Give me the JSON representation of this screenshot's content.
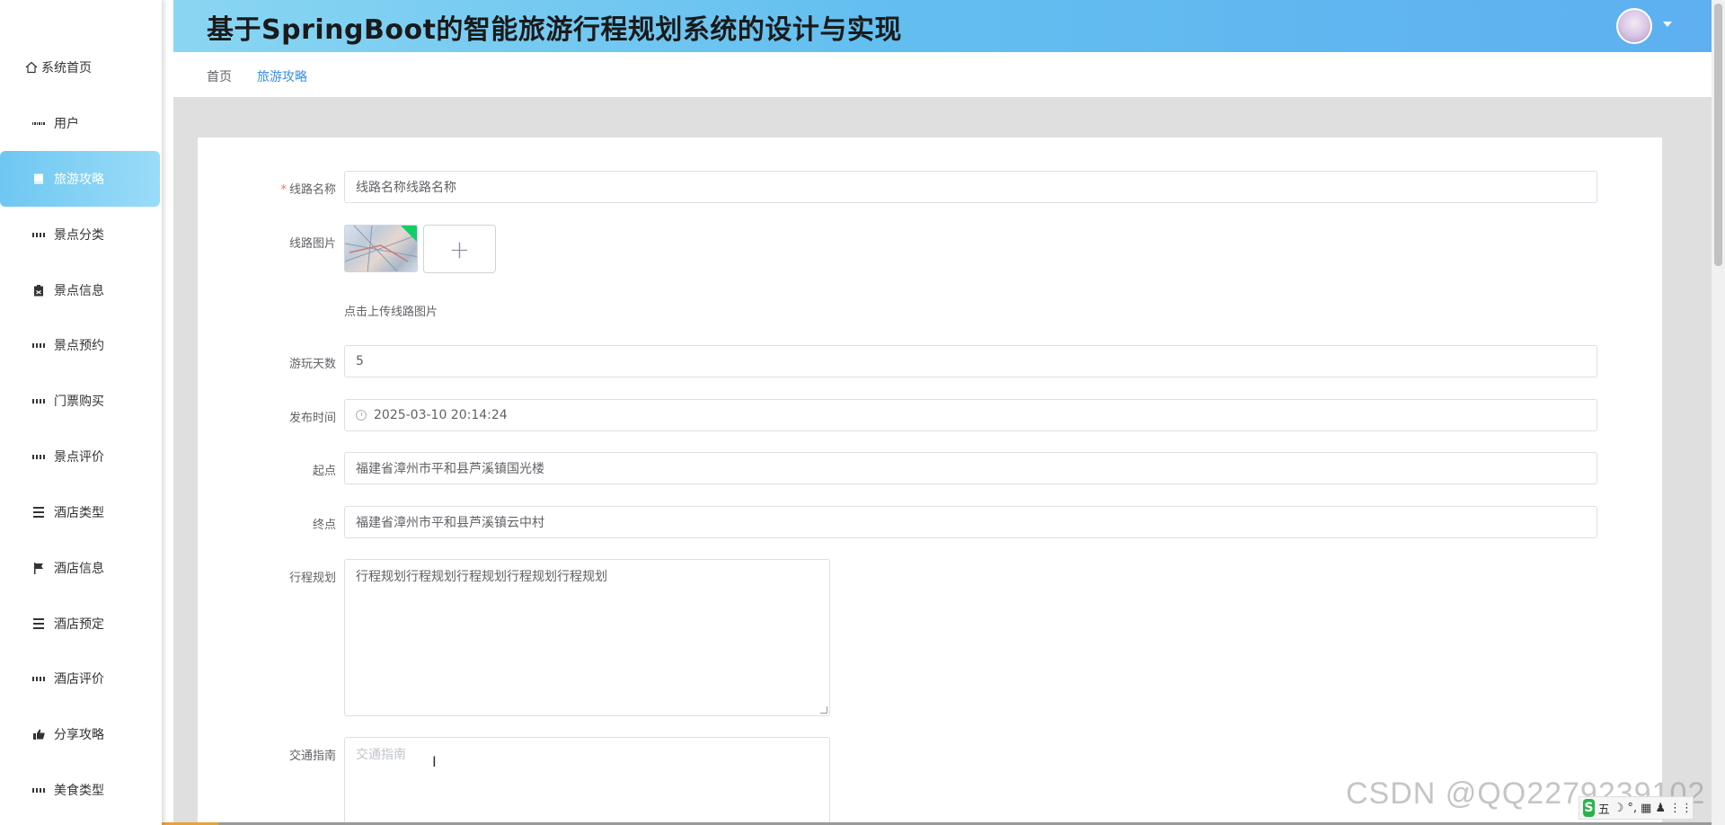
{
  "header": {
    "title": "基于SpringBoot的智能旅游行程规划系统的设计与实现"
  },
  "breadcrumb": {
    "home": "首页",
    "current": "旅游攻略"
  },
  "sidebar": {
    "items": [
      {
        "label": "系统首页",
        "icon": "home-icon"
      },
      {
        "label": "用户",
        "icon": "grid-icon"
      },
      {
        "label": "旅游攻略",
        "icon": "book-icon",
        "active": true
      },
      {
        "label": "景点分类",
        "icon": "grid-icon"
      },
      {
        "label": "景点信息",
        "icon": "clipboard-icon"
      },
      {
        "label": "景点预约",
        "icon": "grid-icon"
      },
      {
        "label": "门票购买",
        "icon": "grid-icon"
      },
      {
        "label": "景点评价",
        "icon": "grid-icon"
      },
      {
        "label": "酒店类型",
        "icon": "list-icon"
      },
      {
        "label": "酒店信息",
        "icon": "flag-icon"
      },
      {
        "label": "酒店预定",
        "icon": "list-icon"
      },
      {
        "label": "酒店评价",
        "icon": "grid-icon"
      },
      {
        "label": "分享攻略",
        "icon": "thumb-icon"
      },
      {
        "label": "美食类型",
        "icon": "grid-icon"
      }
    ]
  },
  "form": {
    "route_name": {
      "label": "线路名称",
      "value": "线路名称线路名称",
      "required": true
    },
    "route_image": {
      "label": "线路图片",
      "upload_tip": "点击上传线路图片",
      "add_symbol": "+"
    },
    "days": {
      "label": "游玩天数",
      "value": "5"
    },
    "publish_time": {
      "label": "发布时间",
      "value": "2025-03-10 20:14:24"
    },
    "start": {
      "label": "起点",
      "value": "福建省漳州市平和县芦溪镇国光楼"
    },
    "end": {
      "label": "终点",
      "value": "福建省漳州市平和县芦溪镇云中村"
    },
    "itinerary": {
      "label": "行程规划",
      "value": "行程规划行程规划行程规划行程规划行程规划"
    },
    "traffic": {
      "label": "交通指南",
      "placeholder": "交通指南"
    }
  },
  "overlay": {
    "watermark": "CSDN @QQ2279239102",
    "ime": [
      "S",
      "五",
      "☽",
      "°,",
      "▦",
      "♟",
      "⋮⋮"
    ]
  },
  "colors": {
    "accent": "#3a8ee6",
    "header_start": "#8ad6f2",
    "header_end": "#5eb0f0",
    "active_nav": "#6ec7f2",
    "required": "#f56c6c"
  }
}
